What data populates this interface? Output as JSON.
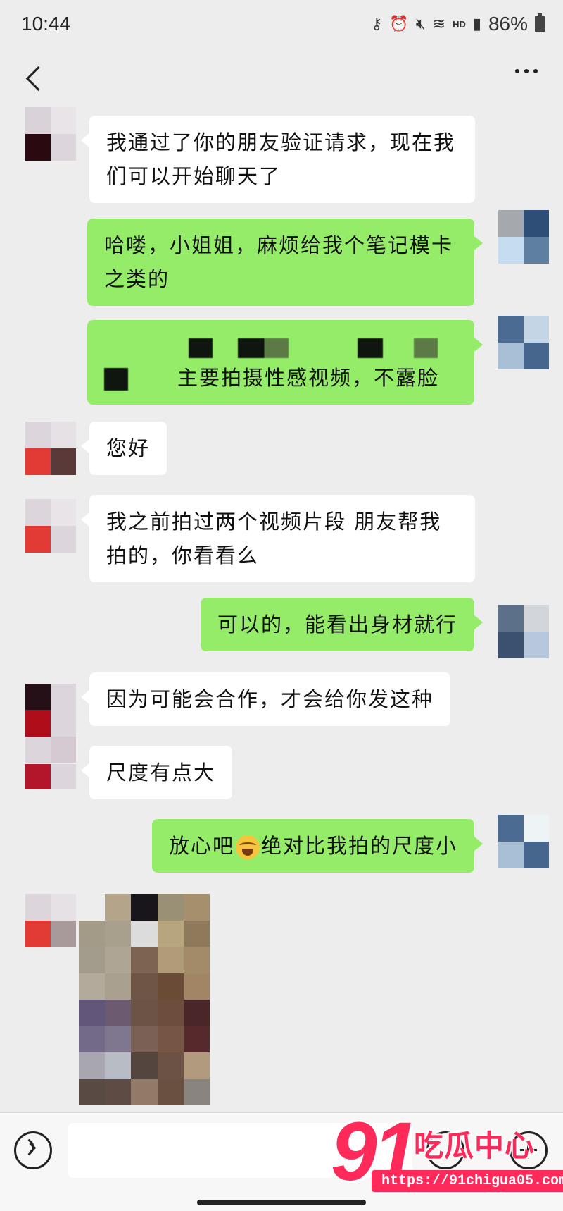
{
  "status_bar": {
    "time": "10:44",
    "network": "HD",
    "battery": "86%"
  },
  "nav": {
    "back_icon": "chevron-left-icon",
    "more_icon": "more-dots-icon"
  },
  "colors": {
    "background": "#ededed",
    "incoming_bubble": "#ffffff",
    "outgoing_bubble": "#95ec69"
  },
  "messages": [
    {
      "side": "in",
      "text": "我通过了你的朋友验证请求，现在我们可以开始聊天了"
    },
    {
      "side": "out",
      "text": "哈喽，小姐姐，麻烦给我个笔记模卡之类的"
    },
    {
      "side": "out",
      "text": "主要拍摄性感视频，不露脸"
    },
    {
      "side": "in",
      "text": "您好"
    },
    {
      "side": "in",
      "text": "我之前拍过两个视频片段 朋友帮我拍的，你看看么"
    },
    {
      "side": "out",
      "text": "可以的，能看出身材就行"
    },
    {
      "side": "in",
      "text": "因为可能会合作，才会给你发这种"
    },
    {
      "side": "in",
      "text": "尺度有点大"
    },
    {
      "side": "out",
      "text_before": "放心吧",
      "emoji": "laughing-crying-emoji",
      "text_after": "绝对比我拍的尺度小"
    },
    {
      "side": "in",
      "type": "image"
    }
  ],
  "input_bar": {
    "voice_icon": "voice-icon",
    "input_value": "",
    "emoji_icon": "emoji-icon",
    "plus_icon": "plus-icon"
  },
  "watermark": {
    "number": "91",
    "text": "吃瓜中心",
    "url": "https://91chigua05.com"
  }
}
